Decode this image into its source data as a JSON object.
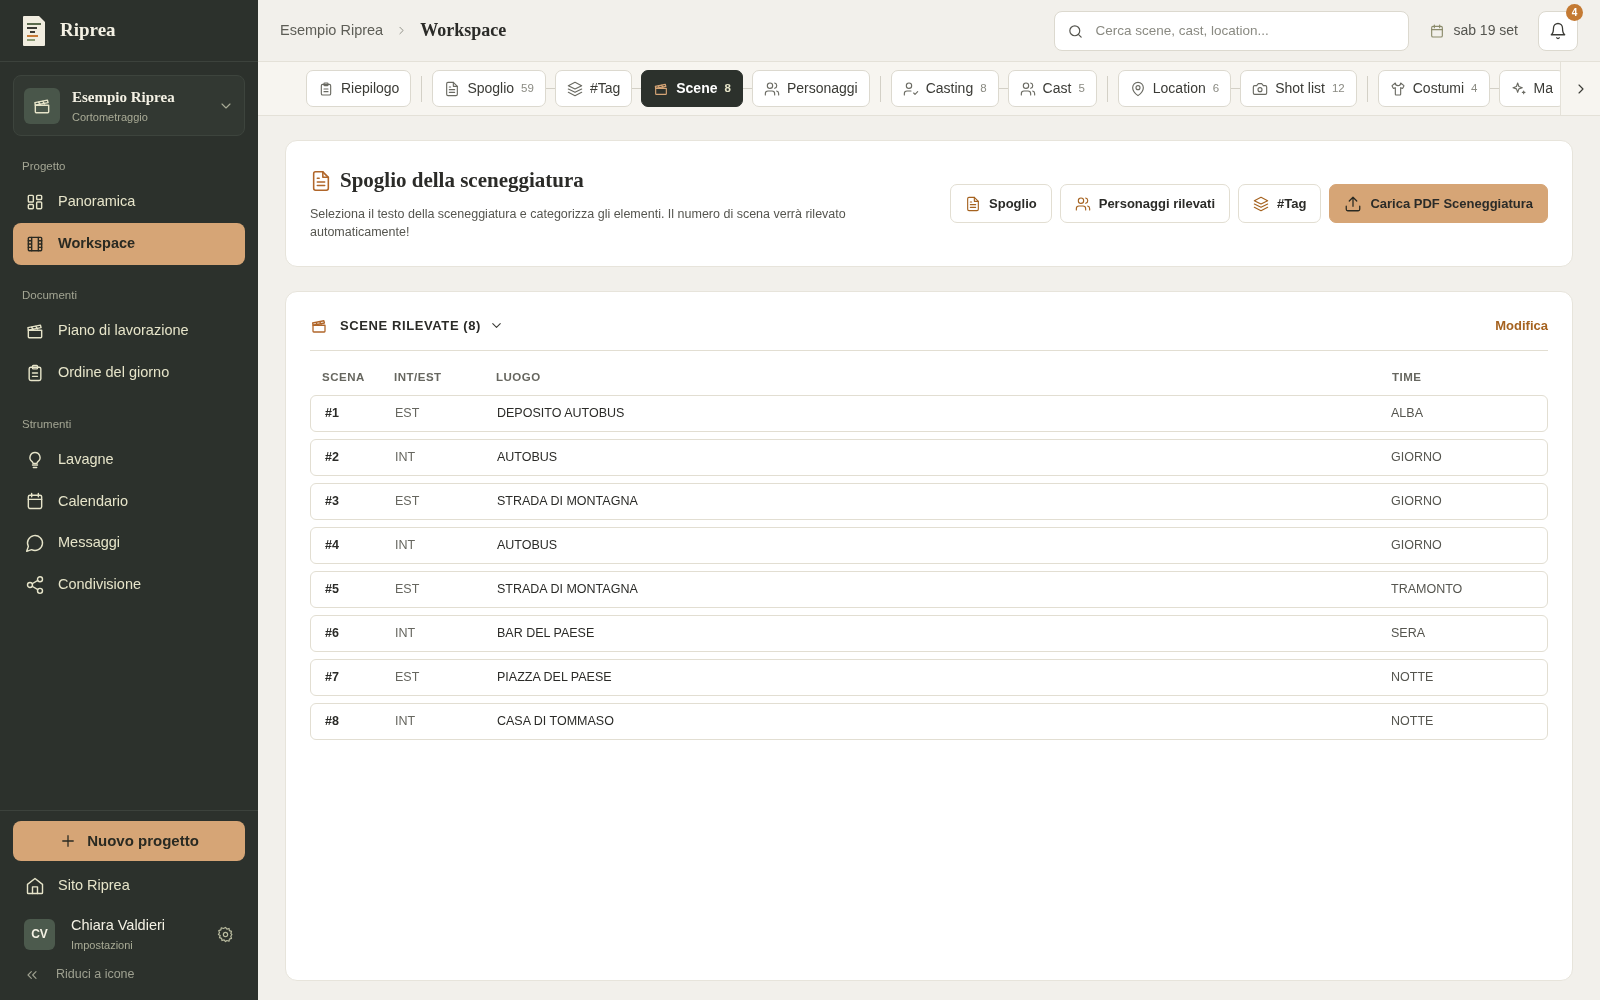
{
  "app": {
    "name": "Riprea"
  },
  "project": {
    "name": "Esempio Riprea",
    "type": "Cortometraggio"
  },
  "sidebar": {
    "sections": [
      {
        "title": "Progetto",
        "items": [
          {
            "label": "Panoramica",
            "selected": false
          },
          {
            "label": "Workspace",
            "selected": true
          }
        ]
      },
      {
        "title": "Documenti",
        "items": [
          {
            "label": "Piano di lavorazione",
            "selected": false
          },
          {
            "label": "Ordine del giorno",
            "selected": false
          }
        ]
      },
      {
        "title": "Strumenti",
        "items": [
          {
            "label": "Lavagne",
            "selected": false
          },
          {
            "label": "Calendario",
            "selected": false
          },
          {
            "label": "Messaggi",
            "selected": false
          },
          {
            "label": "Condivisione",
            "selected": false
          }
        ]
      }
    ],
    "new_project": "Nuovo progetto",
    "site_link": "Sito Riprea",
    "user": {
      "initials": "CV",
      "name": "Chiara Valdieri",
      "subtitle": "Impostazioni"
    },
    "collapse": "Riduci a icone"
  },
  "breadcrumb": [
    "Esempio Riprea",
    "Workspace"
  ],
  "search": {
    "placeholder": "Cerca scene, cast, location..."
  },
  "date": "sab 19 set",
  "notifications": {
    "count": "4"
  },
  "tab_groups": [
    [
      {
        "label": "Riepilogo",
        "selected": false
      }
    ],
    [
      {
        "label": "Spoglio",
        "count": "59",
        "selected": false
      },
      {
        "label": "#Tag",
        "selected": false
      },
      {
        "label": "Scene",
        "count": "8",
        "selected": true
      },
      {
        "label": "Personaggi",
        "selected": false
      }
    ],
    [
      {
        "label": "Casting",
        "count": "8",
        "selected": false
      },
      {
        "label": "Cast",
        "count": "5",
        "selected": false
      }
    ],
    [
      {
        "label": "Location",
        "count": "6",
        "selected": false
      },
      {
        "label": "Shot list",
        "count": "12",
        "selected": false
      }
    ],
    [
      {
        "label": "Costumi",
        "count": "4",
        "selected": false
      },
      {
        "label": "Ma",
        "selected": false
      }
    ]
  ],
  "breakdown": {
    "title": "Spoglio della sceneggiatura",
    "description": "Seleziona il testo della sceneggiatura e categorizza gli elementi. Il numero di scena verrà rilevato automaticamente!",
    "buttons": [
      {
        "label": "Spoglio",
        "kind": "outline"
      },
      {
        "label": "Personaggi rilevati",
        "kind": "outline"
      },
      {
        "label": "#Tag",
        "kind": "outline"
      },
      {
        "label": "Carica PDF Sceneggiatura",
        "kind": "primary"
      }
    ]
  },
  "scenes": {
    "title": "SCENE RILEVATE (8)",
    "expanded": true,
    "edit": "Modifica",
    "columns": [
      "SCENA",
      "INT/EST",
      "LUOGO",
      "TIME"
    ],
    "rows": [
      {
        "scene": "#1",
        "int_est": "EST",
        "location": "DEPOSITO AUTOBUS",
        "time": "ALBA"
      },
      {
        "scene": "#2",
        "int_est": "INT",
        "location": "AUTOBUS",
        "time": "GIORNO"
      },
      {
        "scene": "#3",
        "int_est": "EST",
        "location": "STRADA DI MONTAGNA",
        "time": "GIORNO"
      },
      {
        "scene": "#4",
        "int_est": "INT",
        "location": "AUTOBUS",
        "time": "GIORNO"
      },
      {
        "scene": "#5",
        "int_est": "EST",
        "location": "STRADA DI MONTAGNA",
        "time": "TRAMONTO"
      },
      {
        "scene": "#6",
        "int_est": "INT",
        "location": "BAR DEL PAESE",
        "time": "SERA"
      },
      {
        "scene": "#7",
        "int_est": "EST",
        "location": "PIAZZA DEL PAESE",
        "time": "NOTTE"
      },
      {
        "scene": "#8",
        "int_est": "INT",
        "location": "CASA DI TOMMASO",
        "time": "NOTTE"
      }
    ]
  }
}
